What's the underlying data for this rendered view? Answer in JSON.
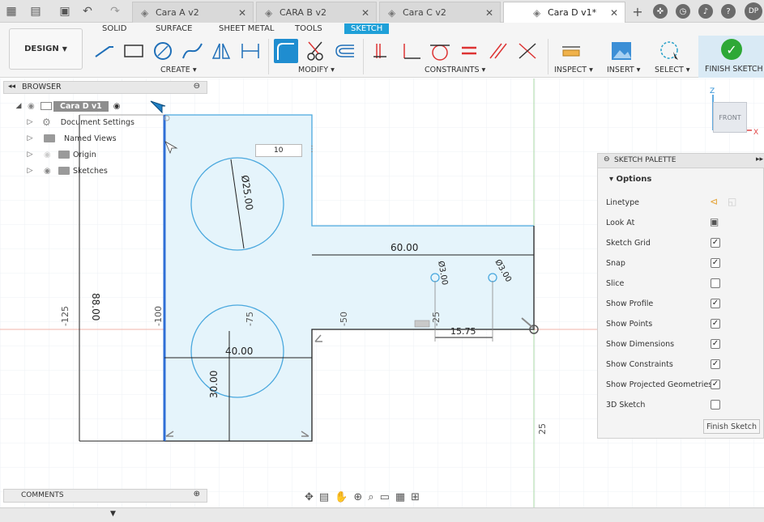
{
  "titlebar": {
    "tabs": [
      {
        "label": "Cara A v2",
        "active": false
      },
      {
        "label": "CARA B v2",
        "active": false
      },
      {
        "label": "Cara C v2",
        "active": false
      },
      {
        "label": "Cara D v1*",
        "active": true
      }
    ],
    "avatar": "DP"
  },
  "ribbon": {
    "workspace": "DESIGN",
    "tabs": [
      "SOLID",
      "SURFACE",
      "SHEET METAL",
      "TOOLS",
      "SKETCH"
    ],
    "active_tab": "SKETCH",
    "groups": [
      "CREATE",
      "MODIFY",
      "CONSTRAINTS",
      "INSPECT",
      "INSERT",
      "SELECT"
    ],
    "finish_sketch": "FINISH SKETCH",
    "accent": "#1fa0d8"
  },
  "browser": {
    "title": "BROWSER",
    "root": "Cara D v1",
    "items": [
      "Document Settings",
      "Named Views",
      "Origin",
      "Sketches"
    ]
  },
  "dimension_input": {
    "value": "10"
  },
  "sketch": {
    "dims": {
      "dia_top": "Ø25.00",
      "h88": "88.00",
      "d60": "60.00",
      "d40": "40.00",
      "d30": "30.00",
      "d15": "15.75",
      "dia3a": "Ø3.00",
      "dia3b": "Ø3.00",
      "n125": "-125",
      "n100": "-100",
      "n75": "-75",
      "n50": "-50",
      "n25": "-25",
      "p25": "25"
    }
  },
  "palette": {
    "title": "SKETCH PALETTE",
    "section": "Options",
    "linetype": "Linetype",
    "look_at": "Look At",
    "options": [
      {
        "label": "Sketch Grid",
        "checked": true
      },
      {
        "label": "Snap",
        "checked": true
      },
      {
        "label": "Slice",
        "checked": false
      },
      {
        "label": "Show Profile",
        "checked": true
      },
      {
        "label": "Show Points",
        "checked": true
      },
      {
        "label": "Show Dimensions",
        "checked": true
      },
      {
        "label": "Show Constraints",
        "checked": true
      },
      {
        "label": "Show Projected Geometries",
        "checked": true
      },
      {
        "label": "3D Sketch",
        "checked": false
      }
    ],
    "finish_button": "Finish Sketch"
  },
  "viewcube": {
    "face": "FRONT",
    "axis_z": "Z",
    "axis_x": "X"
  },
  "comments": {
    "label": "COMMENTS"
  }
}
